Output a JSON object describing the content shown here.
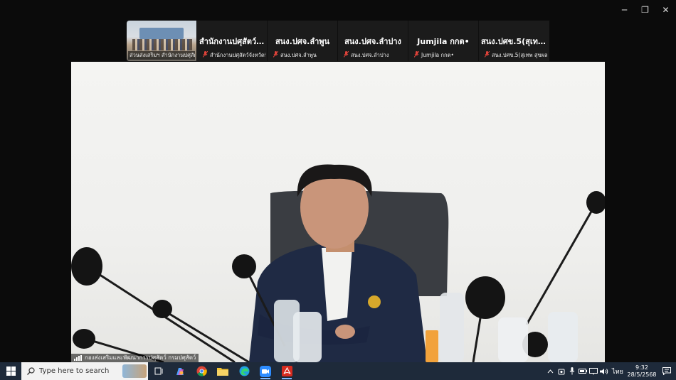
{
  "window": {
    "minimize": "─",
    "restore": "❐",
    "close": "✕"
  },
  "participants": [
    {
      "big_label": "",
      "caption": "ส่วนส่งเสริมฯ สำนักงานปศุสัต...",
      "type": "video"
    },
    {
      "big_label": "สำนักงานปศุสัตว์...",
      "caption": "สำนักงานปศุสัตว์จังหวัดพิ..."
    },
    {
      "big_label": "สนง.ปศจ.ลำพูน",
      "caption": "สนง.ปศจ.ลำพูน"
    },
    {
      "big_label": "สนง.ปศจ.ลำปาง",
      "caption": "สนง.ปศจ.ลำปาง"
    },
    {
      "big_label": "Jumjila กกต•",
      "caption": "Jumjila กกต•"
    },
    {
      "big_label": "สนง.ปศข.5(สุเทพ...",
      "caption": "สนง.ปศข.5(สุเทพ สุขผล)"
    }
  ],
  "speaker": {
    "name": "กองส่งเสริมและพัฒนาการปศุสัตว์ กรมปศุสัตว์"
  },
  "taskbar": {
    "search_placeholder": "Type here to search",
    "language": "ไทย",
    "time": "9:32",
    "date": "28/5/2568",
    "pinned": [
      "task-view",
      "copilot",
      "chrome",
      "file-explorer",
      "edge",
      "zoom",
      "acrobat"
    ]
  },
  "colors": {
    "taskbar": "#1e2a3a",
    "mic_off": "#e0433a",
    "accent": "#7fb8ff"
  }
}
